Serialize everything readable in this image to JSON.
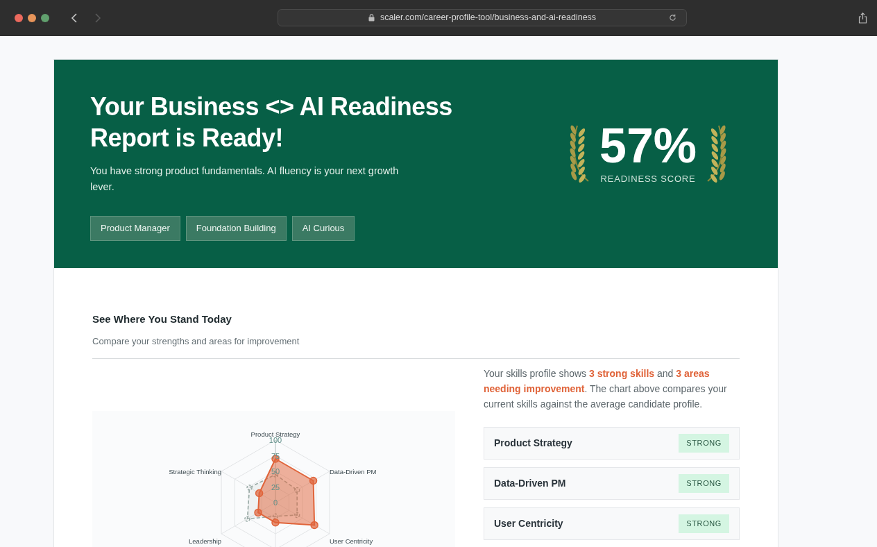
{
  "browser": {
    "url": "scaler.com/career-profile-tool/business-and-ai-readiness",
    "nav": [
      {
        "kind": "back",
        "disabled": false
      },
      {
        "kind": "forward",
        "disabled": true
      }
    ]
  },
  "hero": {
    "title": "Your Business <> AI Readiness Report is Ready!",
    "subtitle": "You have strong product fundamentals. AI fluency is your next growth lever.",
    "tags": [
      "Product Manager",
      "Foundation Building",
      "AI Curious"
    ],
    "score": "57%",
    "score_label": "READINESS SCORE"
  },
  "section": {
    "title": "See Where You Stand Today",
    "subtitle": "Compare your strengths and areas for improvement",
    "radar": {
      "axis_labels": [
        "Product Strategy",
        "Strategic Thinking",
        "Data-Driven PM",
        "Leadership",
        "User Centricity"
      ],
      "tick_labels": [
        "100",
        "75",
        "50",
        "25",
        "0"
      ]
    },
    "summary": "Your skills profile shows **3 strong skills** and **3 areas needing improvement**. The chart above compares your current skills against the average candidate profile.",
    "skills": [
      {
        "name": "Product Strategy",
        "status": "STRONG",
        "kind": "strong"
      },
      {
        "name": "Data-Driven PM",
        "status": "STRONG",
        "kind": "strong"
      },
      {
        "name": "User Centricity",
        "status": "STRONG",
        "kind": "strong"
      }
    ]
  }
}
